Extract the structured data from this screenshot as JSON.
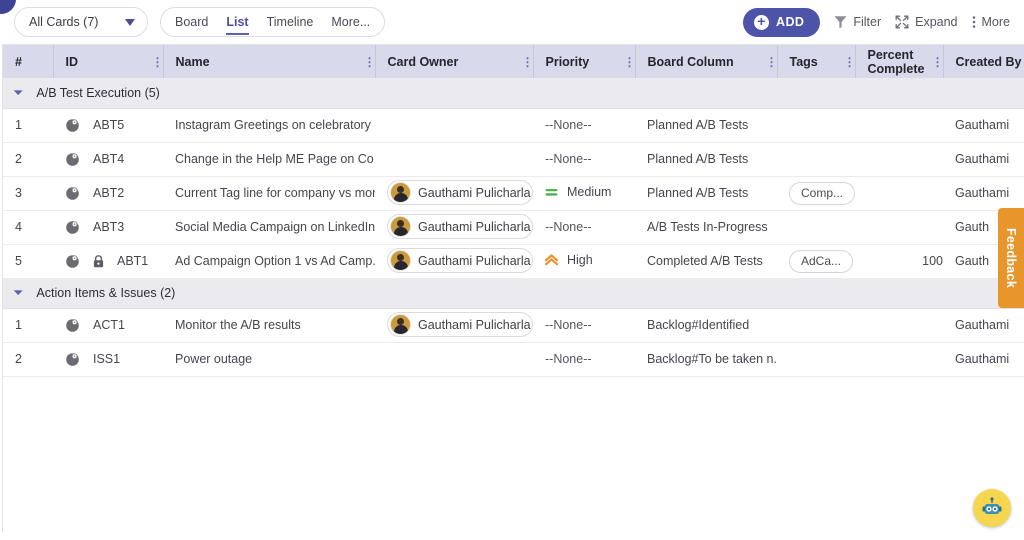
{
  "toolbar": {
    "cards_filter_label": "All Cards (7)",
    "caret_icon": "chevron-down-icon",
    "views": [
      {
        "label": "Board",
        "active": false
      },
      {
        "label": "List",
        "active": true
      },
      {
        "label": "Timeline",
        "active": false
      },
      {
        "label": "More...",
        "active": false
      }
    ],
    "add_label": "ADD",
    "add_icon": "plus-circle-icon",
    "add_color": "#4c53a8",
    "filter_label": "Filter",
    "filter_icon": "funnel-icon",
    "expand_label": "Expand",
    "expand_icon": "expand-arrows-icon",
    "more_label": "More",
    "more_icon": "kebab-vertical-icon"
  },
  "table": {
    "header_bg": "#d8d9ea",
    "columns": [
      {
        "label": "#",
        "kebab": false
      },
      {
        "label": "ID",
        "kebab": true
      },
      {
        "label": "Name",
        "kebab": true
      },
      {
        "label": "Card Owner",
        "kebab": true
      },
      {
        "label": "Priority",
        "kebab": true
      },
      {
        "label": "Board Column",
        "kebab": true
      },
      {
        "label": "Tags",
        "kebab": true
      },
      {
        "label": "Percent Complete",
        "kebab": true
      },
      {
        "label": "Created By",
        "kebab": false
      }
    ],
    "groups": [
      {
        "title": "A/B Test Execution (5)",
        "expanded": true,
        "chevron_icon": "chevron-down-icon",
        "rows": [
          {
            "index": "1",
            "card_icon": "card-type-icon",
            "locked": false,
            "id": "ABT5",
            "name": "Instagram Greetings on celebratory ...",
            "owner": "",
            "priority": "--None--",
            "priority_icon": "",
            "board_column": "Planned A/B Tests",
            "tag": "",
            "percent_complete": "",
            "created_by": "Gauthami"
          },
          {
            "index": "2",
            "card_icon": "card-type-icon",
            "locked": false,
            "id": "ABT4",
            "name": "Change in the Help ME Page on Co...",
            "owner": "",
            "priority": "--None--",
            "priority_icon": "",
            "board_column": "Planned A/B Tests",
            "tag": "",
            "percent_complete": "",
            "created_by": "Gauthami"
          },
          {
            "index": "3",
            "card_icon": "card-type-icon",
            "locked": false,
            "id": "ABT2",
            "name": "Current Tag line for company vs mor...",
            "owner": "Gauthami Pulicharla",
            "priority": "Medium",
            "priority_icon": "priority-medium-icon",
            "board_column": "Planned A/B Tests",
            "tag": "Comp...",
            "percent_complete": "",
            "created_by": "Gauthami"
          },
          {
            "index": "4",
            "card_icon": "card-type-icon",
            "locked": false,
            "id": "ABT3",
            "name": "Social Media Campaign on LinkedIn ...",
            "owner": "Gauthami Pulicharla",
            "priority": "--None--",
            "priority_icon": "",
            "board_column": "A/B Tests In-Progress",
            "tag": "",
            "percent_complete": "",
            "created_by": "Gauth"
          },
          {
            "index": "5",
            "card_icon": "card-type-icon",
            "locked": true,
            "lock_icon": "lock-icon",
            "id": "ABT1",
            "name": "Ad Campaign Option 1 vs Ad Camp...",
            "owner": "Gauthami Pulicharla",
            "priority": "High",
            "priority_icon": "priority-high-icon",
            "board_column": "Completed A/B Tests",
            "tag": "AdCa...",
            "percent_complete": "100",
            "created_by": "Gauth"
          }
        ]
      },
      {
        "title": "Action Items & Issues (2)",
        "expanded": true,
        "chevron_icon": "chevron-down-icon",
        "rows": [
          {
            "index": "1",
            "card_icon": "card-type-icon",
            "locked": false,
            "id": "ACT1",
            "name": "Monitor the A/B results",
            "owner": "Gauthami Pulicharla",
            "priority": "--None--",
            "priority_icon": "",
            "board_column": "Backlog#Identified",
            "tag": "",
            "percent_complete": "",
            "created_by": "Gauthami"
          },
          {
            "index": "2",
            "card_icon": "card-type-icon",
            "locked": false,
            "id": "ISS1",
            "name": "Power outage",
            "owner": "",
            "priority": "--None--",
            "priority_icon": "",
            "board_column": "Backlog#To be taken n...",
            "tag": "",
            "percent_complete": "",
            "created_by": "Gauthami"
          }
        ]
      }
    ]
  },
  "feedback": {
    "label": "Feedback",
    "color": "#e8962c"
  },
  "bot": {
    "icon": "robot-assistant-icon",
    "color": "#f5d64e"
  },
  "colors": {
    "accent": "#4c53a8",
    "priority_medium": "#4caf50",
    "priority_high": "#f0902b"
  }
}
